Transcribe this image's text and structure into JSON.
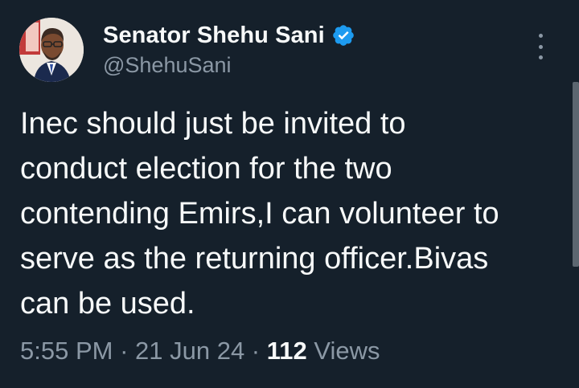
{
  "author": {
    "display_name": "Senator Shehu Sani",
    "handle": "@ShehuSani",
    "verified_icon": "verified-badge-icon",
    "avatar_icon": "profile-photo"
  },
  "tweet": {
    "text_lines": [
      "Inec should just be invited to",
      "conduct election for the two",
      "contending Emirs,I can volunteer to",
      "serve as the returning officer.Bivas",
      "can be used."
    ]
  },
  "meta": {
    "time": "5:55 PM",
    "sep1": " · ",
    "date": "21 Jun 24",
    "sep2": " · ",
    "views_count": "112",
    "views_label": " Views"
  },
  "colors": {
    "background": "#15202b",
    "primary_text": "#f7f9f9",
    "secondary_text": "#8b98a5",
    "verified_blue": "#1d9bf0"
  },
  "menu": {
    "icon": "more-vertical-icon"
  }
}
